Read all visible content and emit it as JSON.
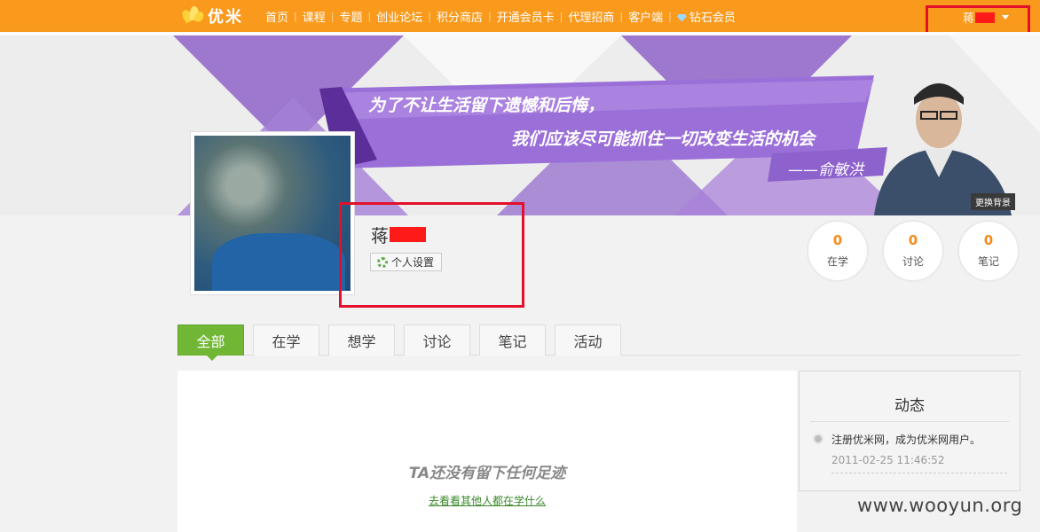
{
  "brand": {
    "logo_text": "优米"
  },
  "nav": {
    "items": [
      "首页",
      "课程",
      "专题",
      "创业论坛",
      "积分商店",
      "开通会员卡",
      "代理招商",
      "客户端"
    ],
    "vip_label": "钻石会员",
    "user_name": "蒋"
  },
  "banner": {
    "quote_line1": "为了不让生活留下遗憾和后悔，",
    "quote_line2": "我们应该尽可能抓住一切改变生活的机会",
    "quote_author": "——俞敏洪",
    "change_bg_label": "更换背景"
  },
  "profile": {
    "name": "蒋",
    "settings_label": "个人设置"
  },
  "stats": [
    {
      "value": "0",
      "label": "在学"
    },
    {
      "value": "0",
      "label": "讨论"
    },
    {
      "value": "0",
      "label": "笔记"
    }
  ],
  "tabs": [
    "全部",
    "在学",
    "想学",
    "讨论",
    "笔记",
    "活动"
  ],
  "feed": {
    "empty_title": "TA还没有留下任何足迹",
    "empty_link": "去看看其他人都在学什么"
  },
  "sidebar": {
    "title": "动态",
    "activity_text": "注册优米网，成为优米网用户。",
    "activity_time": "2011-02-25 11:46:52"
  },
  "watermark": "www.wooyun.org",
  "colors": {
    "nav_bg": "#f99a1c",
    "tab_active": "#72b635",
    "stat_number": "#f48c1d",
    "highlight_box": "#e2102a"
  }
}
